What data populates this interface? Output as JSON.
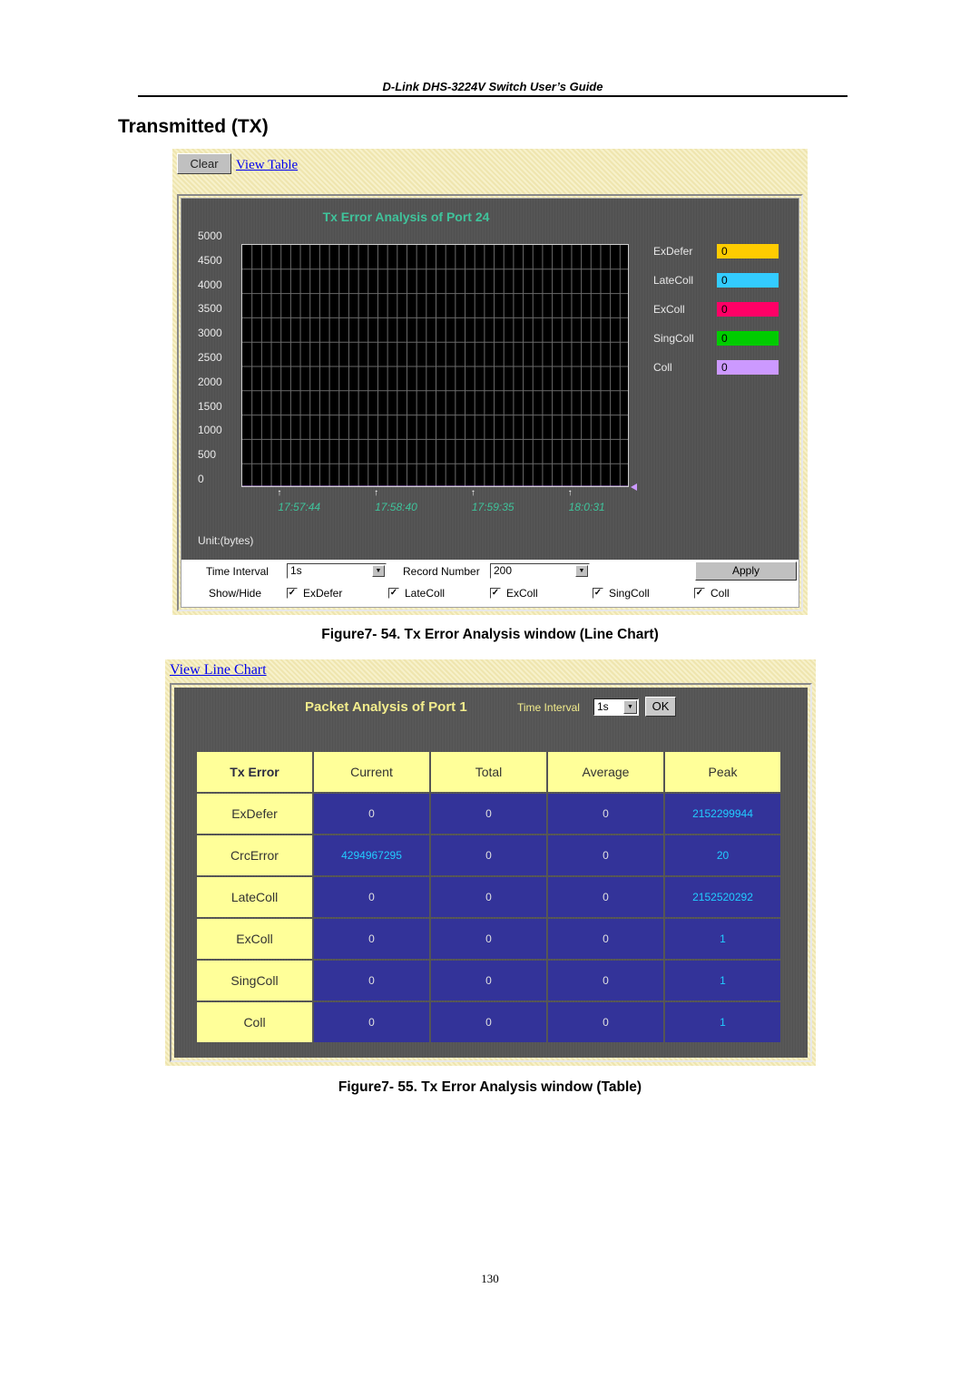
{
  "document": {
    "running_header": "D-Link DHS-3224V Switch User’s Guide",
    "section_title": "Transmitted (TX)",
    "page_number": "130"
  },
  "figure1": {
    "caption": "Figure7- 54.  Tx Error Analysis window (Line Chart)",
    "clear_button": "Clear",
    "view_table_link": "View Table",
    "unit_label": "Unit:(bytes)",
    "legend": [
      {
        "name": "ExDefer",
        "value": "0",
        "color": "#ffcc00"
      },
      {
        "name": "LateColl",
        "value": "0",
        "color": "#33ccff"
      },
      {
        "name": "ExColl",
        "value": "0",
        "color": "#ff0066"
      },
      {
        "name": "SingColl",
        "value": "0",
        "color": "#00cc00"
      },
      {
        "name": "Coll",
        "value": "0",
        "color": "#cc99ff"
      }
    ],
    "controls": {
      "time_interval_label": "Time Interval",
      "time_interval_value": "1s",
      "record_number_label": "Record Number",
      "record_number_value": "200",
      "apply_button": "Apply",
      "show_hide_label": "Show/Hide",
      "checkboxes": [
        {
          "label": "ExDefer",
          "checked": true
        },
        {
          "label": "LateColl",
          "checked": true
        },
        {
          "label": "ExColl",
          "checked": true
        },
        {
          "label": "SingColl",
          "checked": true
        },
        {
          "label": "Coll",
          "checked": true
        }
      ]
    }
  },
  "chart_data": {
    "type": "line",
    "title": "Tx Error Analysis of Port 24",
    "xlabel": "",
    "ylabel": "Unit:(bytes)",
    "ylim": [
      0,
      5000
    ],
    "yticks": [
      "5000",
      "4500",
      "4000",
      "3500",
      "3000",
      "2500",
      "2000",
      "1500",
      "1000",
      "500",
      "0"
    ],
    "x_tick_labels": [
      "17:57:44",
      "17:58:40",
      "17:59:35",
      "18:0:31"
    ],
    "grid": true,
    "grid_columns": 40,
    "grid_rows": 10,
    "legend_position": "right",
    "series": [
      {
        "name": "ExDefer",
        "color": "#ffcc00",
        "values": [
          0
        ]
      },
      {
        "name": "LateColl",
        "color": "#33ccff",
        "values": [
          0
        ]
      },
      {
        "name": "ExColl",
        "color": "#ff0066",
        "values": [
          0
        ]
      },
      {
        "name": "SingColl",
        "color": "#00cc00",
        "values": [
          0
        ]
      },
      {
        "name": "Coll",
        "color": "#cc99ff",
        "values": [
          0
        ]
      }
    ]
  },
  "figure2": {
    "caption": "Figure7- 55.  Tx Error Analysis window (Table)",
    "view_line_chart_link": "View Line Chart",
    "title": "Packet Analysis of Port 1",
    "time_interval_label": "Time Interval",
    "time_interval_value": "1s",
    "ok_button": "OK",
    "table": {
      "headers": [
        "Tx Error",
        "Current",
        "Total",
        "Average",
        "Peak"
      ],
      "rows": [
        {
          "name": "ExDefer",
          "current": "0",
          "total": "0",
          "average": "0",
          "peak": "2152299944"
        },
        {
          "name": "CrcError",
          "current": "4294967295",
          "total": "0",
          "average": "0",
          "peak": "20"
        },
        {
          "name": "LateColl",
          "current": "0",
          "total": "0",
          "average": "0",
          "peak": "2152520292"
        },
        {
          "name": "ExColl",
          "current": "0",
          "total": "0",
          "average": "0",
          "peak": "1"
        },
        {
          "name": "SingColl",
          "current": "0",
          "total": "0",
          "average": "0",
          "peak": "1"
        },
        {
          "name": "Coll",
          "current": "0",
          "total": "0",
          "average": "0",
          "peak": "1"
        }
      ]
    }
  }
}
